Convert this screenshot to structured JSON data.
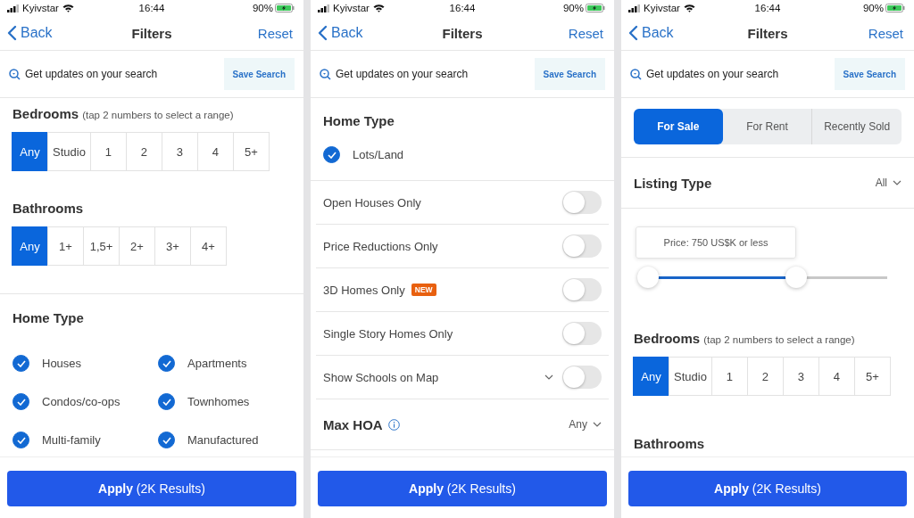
{
  "screens": [
    {
      "status": {
        "carrier": "Kyivstar",
        "time": "16:44",
        "battery": "90%"
      },
      "nav": {
        "back": "Back",
        "title": "Filters",
        "reset": "Reset"
      },
      "save": {
        "text": "Get updates on your search",
        "button": "Save Search"
      },
      "sections": [
        {
          "kind": "segments",
          "title": "Bedrooms",
          "note": "(tap 2 numbers to select a range)",
          "options": [
            {
              "label": "Any",
              "selected": true
            },
            {
              "label": "Studio",
              "selected": false
            },
            {
              "label": "1",
              "selected": false
            },
            {
              "label": "2",
              "selected": false
            },
            {
              "label": "3",
              "selected": false
            },
            {
              "label": "4",
              "selected": false
            },
            {
              "label": "5+",
              "selected": false
            }
          ]
        },
        {
          "kind": "segments",
          "title": "Bathrooms",
          "options": [
            {
              "label": "Any",
              "selected": true
            },
            {
              "label": "1+",
              "selected": false
            },
            {
              "label": "1,5+",
              "selected": false
            },
            {
              "label": "2+",
              "selected": false
            },
            {
              "label": "3+",
              "selected": false
            },
            {
              "label": "4+",
              "selected": false
            }
          ]
        },
        {
          "kind": "checklist",
          "title": "Home Type",
          "items": [
            {
              "label": "Houses",
              "checked": true
            },
            {
              "label": "Apartments",
              "checked": true
            },
            {
              "label": "Condos/co-ops",
              "checked": true
            },
            {
              "label": "Townhomes",
              "checked": true
            },
            {
              "label": "Multi-family",
              "checked": true
            },
            {
              "label": "Manufactured",
              "checked": true
            }
          ]
        }
      ],
      "apply": "**Apply** (2K Results)"
    },
    {
      "status": {
        "carrier": "Kyivstar",
        "time": "16:44",
        "battery": "90%"
      },
      "nav": {
        "back": "Back",
        "title": "Filters",
        "reset": "Reset"
      },
      "save": {
        "text": "Get updates on your search",
        "button": "Save Search"
      },
      "sections": [
        {
          "kind": "checklist",
          "title": "Home Type",
          "items": [
            {
              "label": "Lots/Land",
              "checked": true
            }
          ]
        },
        {
          "kind": "toggle",
          "label": "Open Houses Only",
          "on": false
        },
        {
          "kind": "toggle",
          "label": "Price Reductions Only",
          "on": false
        },
        {
          "kind": "toggle",
          "label": "3D Homes Only",
          "badge": "NEW",
          "on": false
        },
        {
          "kind": "toggle",
          "label": "Single Story Homes Only",
          "on": false
        },
        {
          "kind": "toggle",
          "label": "Show Schools on Map",
          "expandable": true,
          "on": false
        },
        {
          "kind": "dropdown",
          "title": "Max HOA",
          "info": true,
          "value": "Any"
        }
      ],
      "apply": "**Apply** (2K Results)"
    },
    {
      "status": {
        "carrier": "Kyivstar",
        "time": "16:44",
        "battery": "90%"
      },
      "nav": {
        "back": "Back",
        "title": "Filters",
        "reset": "Reset"
      },
      "save": {
        "text": "Get updates on your search",
        "button": "Save Search"
      },
      "sections": [
        {
          "kind": "tabs",
          "options": [
            {
              "label": "For Sale",
              "selected": true
            },
            {
              "label": "For Rent",
              "selected": false
            },
            {
              "label": "Recently Sold",
              "selected": false
            }
          ]
        },
        {
          "kind": "dropdown",
          "title": "Listing Type",
          "value": "All"
        },
        {
          "kind": "slider",
          "tooltip": "Price: 750 US$K or less",
          "level": 0.57
        },
        {
          "kind": "segments",
          "title": "Bedrooms",
          "note": "(tap 2 numbers to select a range)",
          "options": [
            {
              "label": "Any",
              "selected": true
            },
            {
              "label": "Studio",
              "selected": false
            },
            {
              "label": "1",
              "selected": false
            },
            {
              "label": "2",
              "selected": false
            },
            {
              "label": "3",
              "selected": false
            },
            {
              "label": "4",
              "selected": false
            },
            {
              "label": "5+",
              "selected": false
            }
          ]
        },
        {
          "kind": "heading",
          "title": "Bathrooms"
        }
      ],
      "apply": "**Apply** (2K Results)"
    }
  ]
}
